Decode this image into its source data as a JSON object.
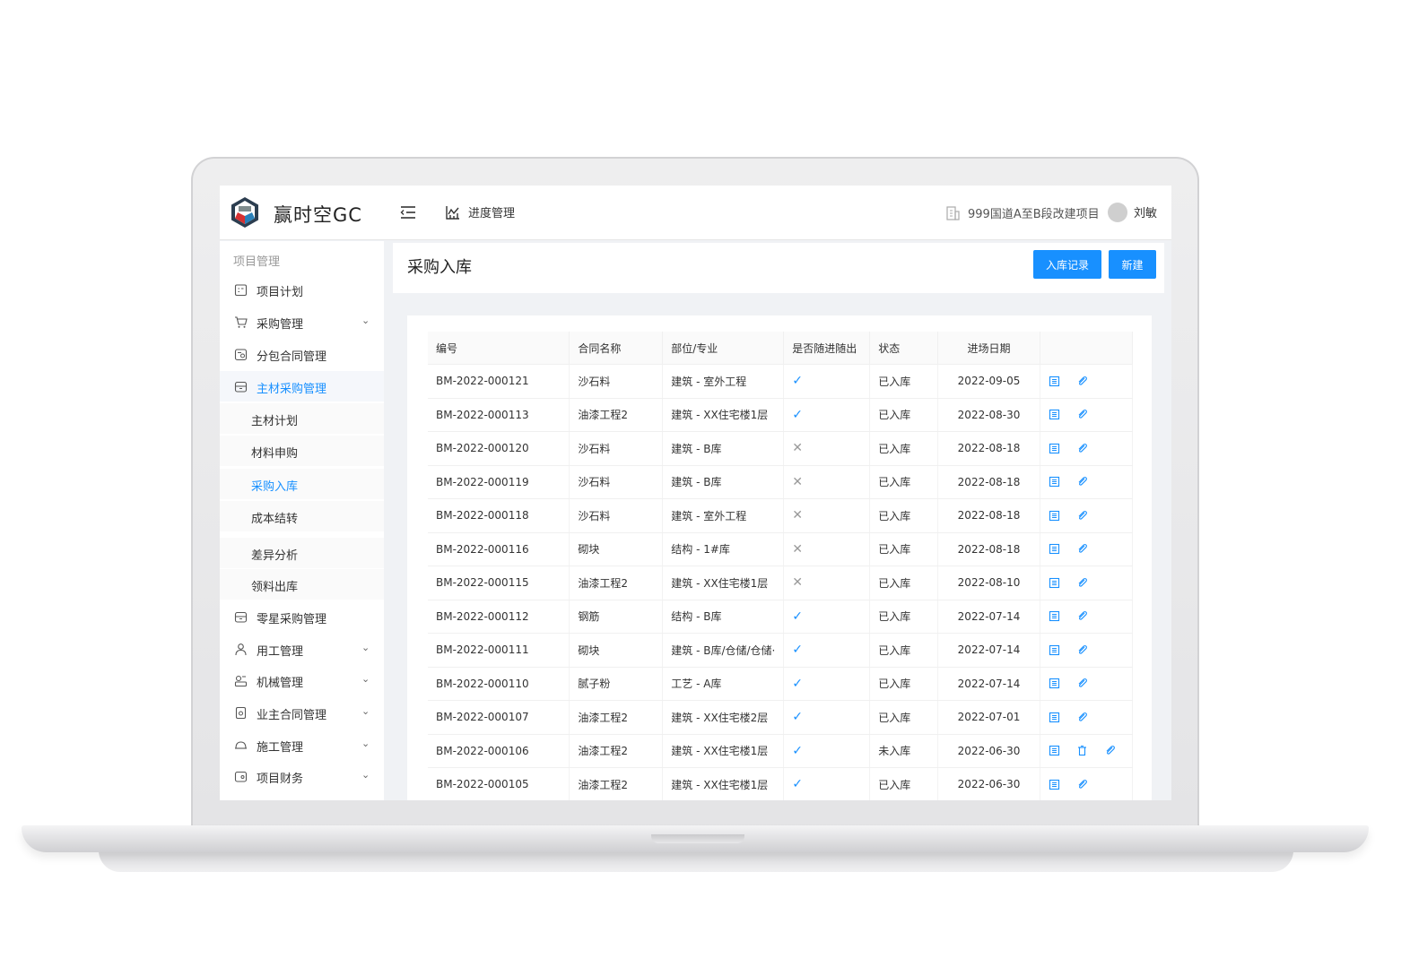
{
  "app": {
    "brand": "赢时空GC",
    "nav_progress": "进度管理",
    "project_name": "999国道A至B段改建项目",
    "user_name": "刘敏"
  },
  "sidebar": {
    "section": "项目管理",
    "items": [
      {
        "label": "项目计划"
      },
      {
        "label": "采购管理"
      },
      {
        "label": "分包合同管理"
      },
      {
        "label": "主材采购管理"
      },
      {
        "label": "主材计划"
      },
      {
        "label": "材料申购"
      },
      {
        "label": "采购入库"
      },
      {
        "label": "成本结转"
      },
      {
        "label": "差异分析"
      },
      {
        "label": "领料出库"
      },
      {
        "label": "零星采购管理"
      },
      {
        "label": "用工管理"
      },
      {
        "label": "机械管理"
      },
      {
        "label": "业主合同管理"
      },
      {
        "label": "施工管理"
      },
      {
        "label": "项目财务"
      }
    ]
  },
  "page": {
    "title": "采购入库",
    "btn_record": "入库记录",
    "btn_new": "新建"
  },
  "table": {
    "headers": [
      "编号",
      "合同名称",
      "部位/专业",
      "是否随进随出",
      "状态",
      "进场日期",
      ""
    ],
    "rows": [
      {
        "id": "BM-2022-000121",
        "contract": "沙石料",
        "part": "建筑 - 室外工程",
        "flag": "✓",
        "status": "已入库",
        "date": "2022-09-05"
      },
      {
        "id": "BM-2022-000113",
        "contract": "油漆工程2",
        "part": "建筑 - XX住宅楼1层",
        "flag": "✓",
        "status": "已入库",
        "date": "2022-08-30"
      },
      {
        "id": "BM-2022-000120",
        "contract": "沙石料",
        "part": "建筑 - B库",
        "flag": "✕",
        "status": "已入库",
        "date": "2022-08-18"
      },
      {
        "id": "BM-2022-000119",
        "contract": "沙石料",
        "part": "建筑 - B库",
        "flag": "✕",
        "status": "已入库",
        "date": "2022-08-18"
      },
      {
        "id": "BM-2022-000118",
        "contract": "沙石料",
        "part": "建筑 - 室外工程",
        "flag": "✕",
        "status": "已入库",
        "date": "2022-08-18"
      },
      {
        "id": "BM-2022-000116",
        "contract": "砌块",
        "part": "结构 - 1#库",
        "flag": "✕",
        "status": "已入库",
        "date": "2022-08-18"
      },
      {
        "id": "BM-2022-000115",
        "contract": "油漆工程2",
        "part": "建筑 - XX住宅楼1层",
        "flag": "✕",
        "status": "已入库",
        "date": "2022-08-10"
      },
      {
        "id": "BM-2022-000112",
        "contract": "钢筋",
        "part": "结构 - B库",
        "flag": "✓",
        "status": "已入库",
        "date": "2022-07-14"
      },
      {
        "id": "BM-2022-000111",
        "contract": "砌块",
        "part": "建筑 - B库/仓储/仓储·",
        "flag": "✓",
        "status": "已入库",
        "date": "2022-07-14"
      },
      {
        "id": "BM-2022-000110",
        "contract": "腻子粉",
        "part": "工艺 - A库",
        "flag": "✓",
        "status": "已入库",
        "date": "2022-07-14"
      },
      {
        "id": "BM-2022-000107",
        "contract": "油漆工程2",
        "part": "建筑 - XX住宅楼2层",
        "flag": "✓",
        "status": "已入库",
        "date": "2022-07-01"
      },
      {
        "id": "BM-2022-000106",
        "contract": "油漆工程2",
        "part": "建筑 - XX住宅楼1层",
        "flag": "✓",
        "status": "未入库",
        "date": "2022-06-30"
      },
      {
        "id": "BM-2022-000105",
        "contract": "油漆工程2",
        "part": "建筑 - XX住宅楼1层",
        "flag": "✓",
        "status": "已入库",
        "date": "2022-06-30"
      }
    ]
  },
  "colors": {
    "accent": "#1890ff",
    "bg": "#f0f2f5"
  }
}
